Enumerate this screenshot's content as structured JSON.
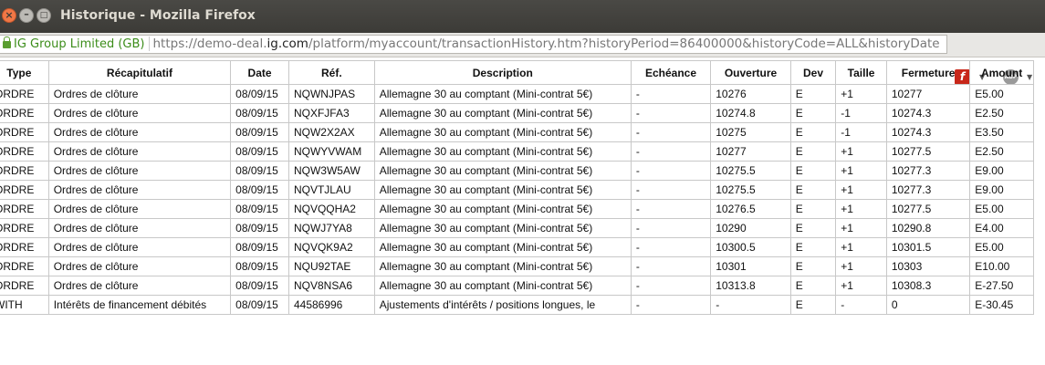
{
  "window": {
    "title": "Historique - Mozilla Firefox",
    "close_glyph": "×",
    "min_glyph": "–",
    "max_glyph": "□"
  },
  "urlbar": {
    "org": "IG Group Limited (GB)",
    "prefix": "https://demo-deal.",
    "domain": "ig.com",
    "path": "/platform/myaccount/transactionHistory.htm?historyPeriod=86400000&historyCode=ALL&historyDate"
  },
  "icons": {
    "flash": "f",
    "abp": "ABP",
    "dropdown": "▼"
  },
  "table": {
    "headers": [
      "Type",
      "Récapitulatif",
      "Date",
      "Réf.",
      "Description",
      "Echéance",
      "Ouverture",
      "Dev",
      "Taille",
      "Fermeture",
      "Amount"
    ],
    "rows": [
      [
        "ORDRE",
        "Ordres de clôture",
        "08/09/15",
        "NQWNJPAS",
        "Allemagne 30 au comptant (Mini-contrat 5€)",
        "-",
        "10276",
        "E",
        "+1",
        "10277",
        "E5.00"
      ],
      [
        "ORDRE",
        "Ordres de clôture",
        "08/09/15",
        "NQXFJFA3",
        "Allemagne 30 au comptant (Mini-contrat 5€)",
        "-",
        "10274.8",
        "E",
        "-1",
        "10274.3",
        "E2.50"
      ],
      [
        "ORDRE",
        "Ordres de clôture",
        "08/09/15",
        "NQW2X2AX",
        "Allemagne 30 au comptant (Mini-contrat 5€)",
        "-",
        "10275",
        "E",
        "-1",
        "10274.3",
        "E3.50"
      ],
      [
        "ORDRE",
        "Ordres de clôture",
        "08/09/15",
        "NQWYVWAM",
        "Allemagne 30 au comptant (Mini-contrat 5€)",
        "-",
        "10277",
        "E",
        "+1",
        "10277.5",
        "E2.50"
      ],
      [
        "ORDRE",
        "Ordres de clôture",
        "08/09/15",
        "NQW3W5AW",
        "Allemagne 30 au comptant (Mini-contrat 5€)",
        "-",
        "10275.5",
        "E",
        "+1",
        "10277.3",
        "E9.00"
      ],
      [
        "ORDRE",
        "Ordres de clôture",
        "08/09/15",
        "NQVTJLAU",
        "Allemagne 30 au comptant (Mini-contrat 5€)",
        "-",
        "10275.5",
        "E",
        "+1",
        "10277.3",
        "E9.00"
      ],
      [
        "ORDRE",
        "Ordres de clôture",
        "08/09/15",
        "NQVQQHA2",
        "Allemagne 30 au comptant (Mini-contrat 5€)",
        "-",
        "10276.5",
        "E",
        "+1",
        "10277.5",
        "E5.00"
      ],
      [
        "ORDRE",
        "Ordres de clôture",
        "08/09/15",
        "NQWJ7YA8",
        "Allemagne 30 au comptant (Mini-contrat 5€)",
        "-",
        "10290",
        "E",
        "+1",
        "10290.8",
        "E4.00"
      ],
      [
        "ORDRE",
        "Ordres de clôture",
        "08/09/15",
        "NQVQK9A2",
        "Allemagne 30 au comptant (Mini-contrat 5€)",
        "-",
        "10300.5",
        "E",
        "+1",
        "10301.5",
        "E5.00"
      ],
      [
        "ORDRE",
        "Ordres de clôture",
        "08/09/15",
        "NQU92TAE",
        "Allemagne 30 au comptant (Mini-contrat 5€)",
        "-",
        "10301",
        "E",
        "+1",
        "10303",
        "E10.00"
      ],
      [
        "ORDRE",
        "Ordres de clôture",
        "08/09/15",
        "NQV8NSA6",
        "Allemagne 30 au comptant (Mini-contrat 5€)",
        "-",
        "10313.8",
        "E",
        "+1",
        "10308.3",
        "E-27.50"
      ],
      [
        "WITH",
        "Intérêts de financement débités",
        "08/09/15",
        "44586996",
        "Ajustements d'intérêts / positions longues, le",
        "-",
        "-",
        "E",
        "-",
        "0",
        "E-30.45"
      ]
    ]
  }
}
